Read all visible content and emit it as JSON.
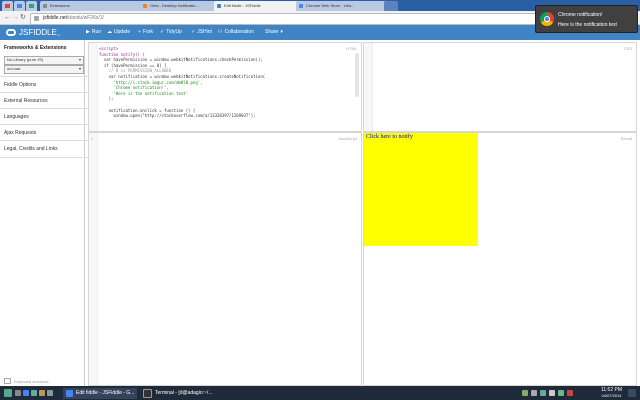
{
  "browser": {
    "tabs": [
      {
        "label": "Extensions"
      },
      {
        "label": "Gets - Desktop Notificatio..."
      },
      {
        "label": "Edit fiddle - JSFiddle"
      },
      {
        "label": "Chrome Web Store - Uba..."
      }
    ],
    "url_host": "jsfiddle.net",
    "url_path": "/dandu/wF26x/1/"
  },
  "toolbar": {
    "logo": "JSFIDDLE",
    "version": "α",
    "run": "Run",
    "update": "Update",
    "fork": "Fork",
    "tidyup": "TidyUp",
    "jshint": "JSHint",
    "collaboration": "Collaboration",
    "share": "Share"
  },
  "sidebar": {
    "title": "Frameworks & Extensions",
    "framework_select": "No-Library (pure JS)",
    "load_select": "onLoad",
    "items": [
      "Fiddle Options",
      "External Resources",
      "Languages",
      "Ajax Requests",
      "Legal, Credits and Links"
    ],
    "keyboard_shortcuts": "Keyboard shortcuts"
  },
  "panels": {
    "html_label": "HTML",
    "css_label": "CSS",
    "js_label": "JavaScript",
    "result_label": "Result",
    "js_line": "1"
  },
  "code_lines": [
    "<script>",
    "function notify() {",
    "  var havePermission = window.webkitNotifications.checkPermission();",
    "  if (havePermission == 0) {",
    "    // 0 is PERMISSION_ALLOWED",
    "    var notification = window.webkitNotifications.createNotification(",
    "      'http://i.stack.imgur.com/dmHl0.png',",
    "      'Chrome notification!',",
    "      'Here is the notification text'",
    "    );",
    "",
    "    notification.onclick = function () {",
    "      window.open(\"http://stackoverflow.com/a/13328397/1269037\");"
  ],
  "result": {
    "link_text": "Click here to notify",
    "box_color": "#ffff00"
  },
  "notification": {
    "title": "Chrome notification!",
    "body": "Here is the notification text"
  },
  "taskbar": {
    "items": [
      {
        "label": "Edit fiddle - JSFiddle - G..."
      },
      {
        "label": "Terminal - [d@adagio:~/..."
      }
    ],
    "time": "11:52 PM",
    "date": "04/07/2014"
  }
}
